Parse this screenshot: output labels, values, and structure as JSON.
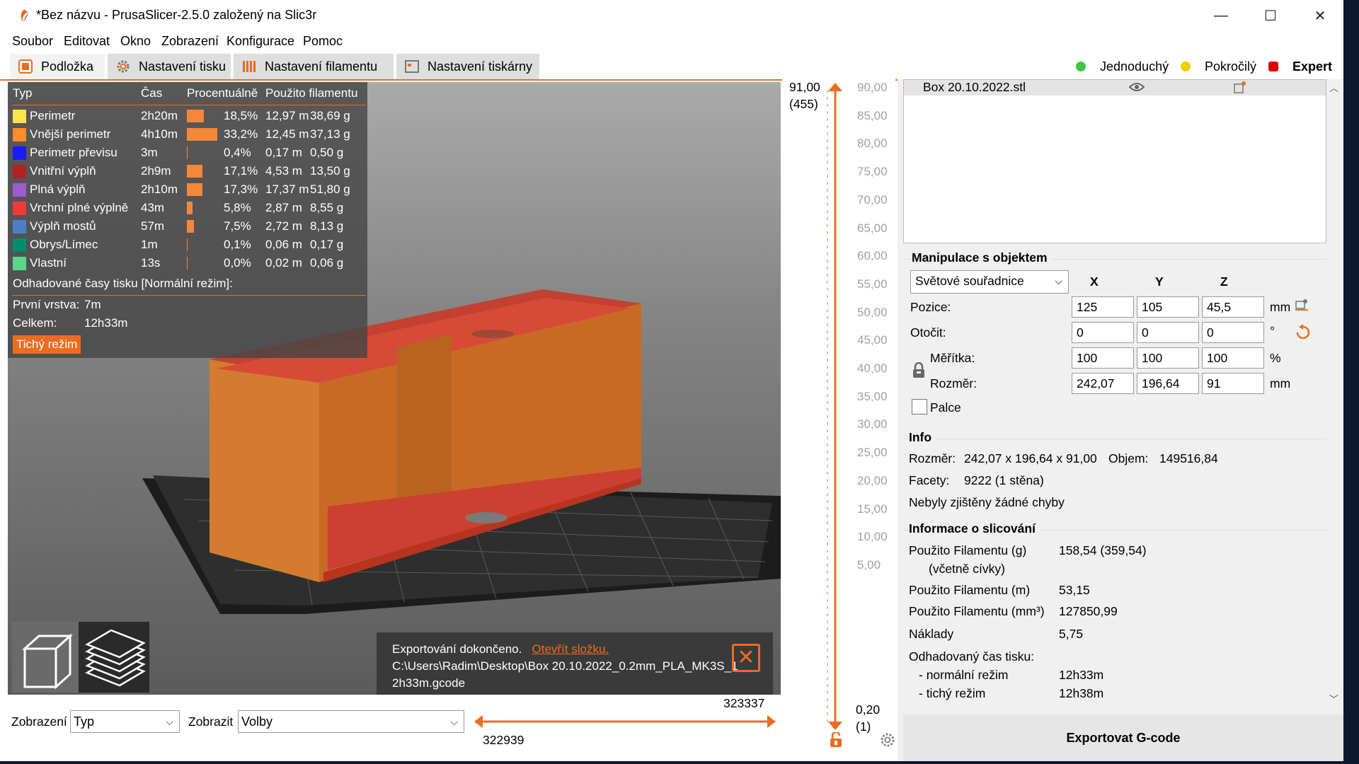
{
  "window": {
    "title": "*Bez názvu - PrusaSlicer-2.5.0 založený na Slic3r",
    "minimize": "—",
    "maximize": "☐",
    "close": "✕"
  },
  "menu": [
    "Soubor",
    "Editovat",
    "Okno",
    "Zobrazení",
    "Konfigurace",
    "Pomoc"
  ],
  "tabs": [
    "Podložka",
    "Nastavení tisku",
    "Nastavení filamentu",
    "Nastavení tiskárny"
  ],
  "modes": [
    {
      "label": "Jednoduchý",
      "color": "#3ec83e"
    },
    {
      "label": "Pokročilý",
      "color": "#f0d000"
    },
    {
      "label": "Expert",
      "color": "#e00000"
    }
  ],
  "legend": {
    "headers": [
      "Typ",
      "Čas",
      "Procentuálně",
      "Použito filamentu"
    ],
    "rows": [
      {
        "type": "Perimetr",
        "time": "2h20m",
        "pct": "18,5%",
        "len": "12,97 m",
        "weight": "38,69 g",
        "color": "#ffe34b",
        "fraction": 0.185
      },
      {
        "type": "Vnější perimetr",
        "time": "4h10m",
        "pct": "33,2%",
        "len": "12,45 m",
        "weight": "37,13 g",
        "color": "#ff8d2a",
        "fraction": 0.332
      },
      {
        "type": "Perimetr převisu",
        "time": "3m",
        "pct": "0,4%",
        "len": "0,17 m",
        "weight": "0,50 g",
        "color": "#1a1aff",
        "fraction": 0.004
      },
      {
        "type": "Vnitřní výplň",
        "time": "2h9m",
        "pct": "17,1%",
        "len": "4,53 m",
        "weight": "13,50 g",
        "color": "#b22222",
        "fraction": 0.171
      },
      {
        "type": "Plná výplň",
        "time": "2h10m",
        "pct": "17,3%",
        "len": "17,37 m",
        "weight": "51,80 g",
        "color": "#9a5ccf",
        "fraction": 0.173
      },
      {
        "type": "Vrchní plné výplně",
        "time": "43m",
        "pct": "5,8%",
        "len": "2,87 m",
        "weight": "8,55 g",
        "color": "#f03a3a",
        "fraction": 0.058
      },
      {
        "type": "Výplň mostů",
        "time": "57m",
        "pct": "7,5%",
        "len": "2,72 m",
        "weight": "8,13 g",
        "color": "#4d7fc7",
        "fraction": 0.075
      },
      {
        "type": "Obrys/Límec",
        "time": "1m",
        "pct": "0,1%",
        "len": "0,06 m",
        "weight": "0,17 g",
        "color": "#008c6e",
        "fraction": 0.001
      },
      {
        "type": "Vlastní",
        "time": "13s",
        "pct": "0,0%",
        "len": "0,02 m",
        "weight": "0,06 g",
        "color": "#5cd68c",
        "fraction": 0.0
      }
    ],
    "estimated_title": "Odhadované časy tisku [Normální režim]:",
    "first_layer_label": "První vrstva:",
    "first_layer_value": "7m",
    "total_label": "Celkem:",
    "total_value": "12h33m",
    "silent_mode": "Tichý režim"
  },
  "toast": {
    "text": "Exportování dokončeno.",
    "link": "Otevřít složku.",
    "path_line1": "C:\\Users\\Radim\\Desktop\\Box 20.10.2022_0.2mm_PLA_MK3S_1",
    "path_line2": "2h33m.gcode"
  },
  "bottom": {
    "view_label": "Zobrazení",
    "view_value": "Typ",
    "show_label": "Zobrazit",
    "show_value": "Volby",
    "hslider_top": "323337",
    "hslider_bottom": "322939"
  },
  "vslider": {
    "top_value": "91,00",
    "top_layer": "(455)",
    "bottom_value": "0,20",
    "bottom_layer": "(1)",
    "ticks": [
      "90,00",
      "85,00",
      "80,00",
      "75,00",
      "70,00",
      "65,00",
      "60,00",
      "55,00",
      "50,00",
      "45,00",
      "40,00",
      "35,00",
      "30,00",
      "25,00",
      "20,00",
      "15,00",
      "10,00",
      "5,00"
    ]
  },
  "objects": [
    {
      "name": "Box 20.10.2022.stl"
    }
  ],
  "manipulation": {
    "title": "Manipulace s objektem",
    "coord_system": "Světové souřadnice",
    "axes": [
      "X",
      "Y",
      "Z"
    ],
    "position_label": "Pozice:",
    "position": [
      "125",
      "105",
      "45,5"
    ],
    "position_unit": "mm",
    "rotate_label": "Otočit:",
    "rotate": [
      "0",
      "0",
      "0"
    ],
    "rotate_unit": "°",
    "scale_label": "Měřítka:",
    "scale": [
      "100",
      "100",
      "100"
    ],
    "scale_unit": "%",
    "size_label": "Rozměr:",
    "size": [
      "242,07",
      "196,64",
      "91"
    ],
    "size_unit": "mm",
    "inches_label": "Palce"
  },
  "info": {
    "title": "Info",
    "size_label": "Rozměr:",
    "size_value": "242,07 x 196,64 x 91,00",
    "volume_label": "Objem:",
    "volume_value": "149516,84",
    "facets_label": "Facety:",
    "facets_value": "9222 (1 stěna)",
    "errors": "Nebyly zjištěny žádné chyby"
  },
  "slicing": {
    "title": "Informace o slicování",
    "rows": [
      {
        "label": "Použito Filamentu (g)",
        "value": "158,54 (359,54)"
      },
      {
        "label": "(včetně cívky)",
        "value": ""
      },
      {
        "label": "Použito Filamentu (m)",
        "value": "53,15"
      },
      {
        "label": "Použito Filamentu (mm³)",
        "value": "127850,99"
      },
      {
        "label": "Náklady",
        "value": "5,75"
      },
      {
        "label": "Odhadovaný čas tisku:",
        "value": ""
      },
      {
        "label": "- normální režim",
        "value": "12h33m"
      },
      {
        "label": "- tichý režim",
        "value": "12h38m"
      }
    ]
  },
  "export_button": "Exportovat G-code"
}
